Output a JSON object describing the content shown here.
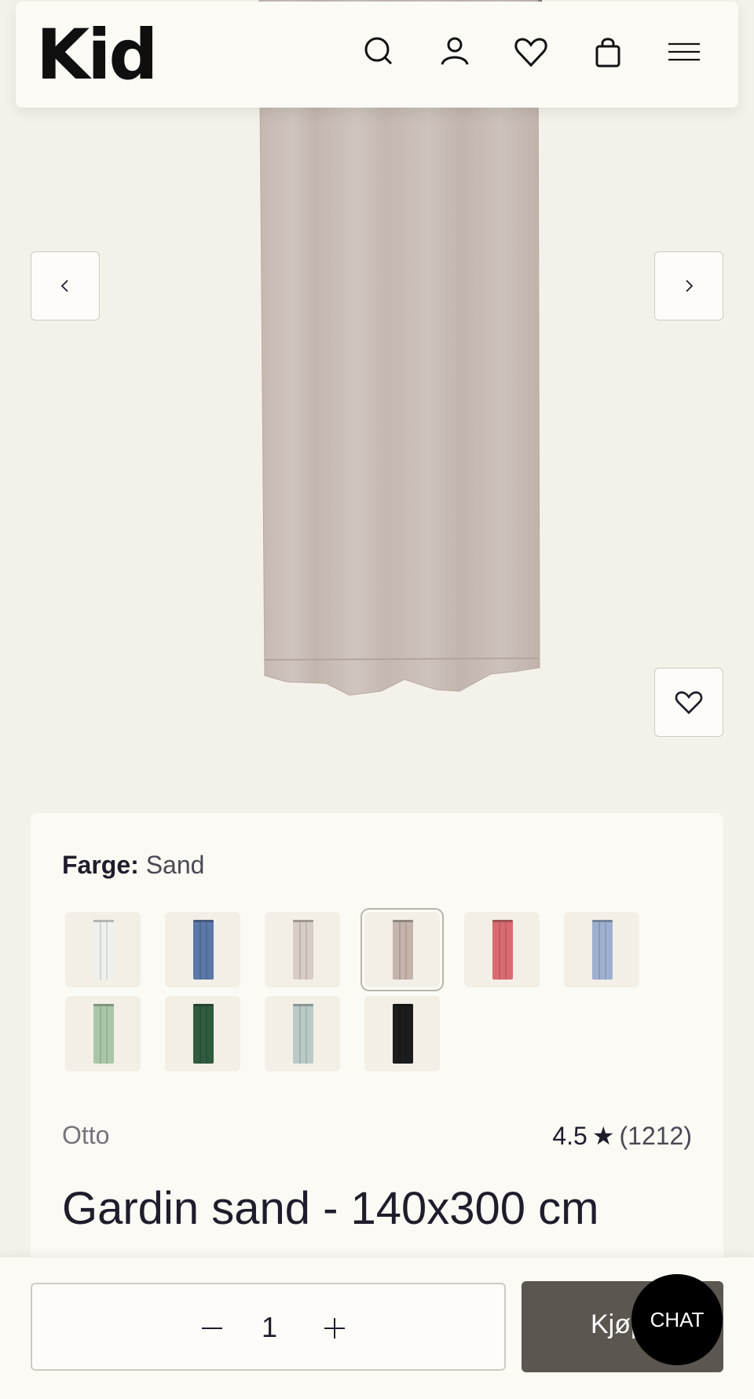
{
  "header": {
    "logo": "Kid",
    "icons": [
      "search-icon",
      "account-icon",
      "heart-icon",
      "bag-icon",
      "menu-icon"
    ]
  },
  "gallery": {
    "prev_icon": "chevron-left-icon",
    "next_icon": "chevron-right-icon",
    "wishlist_icon": "heart-icon",
    "image_color": "#c9bdb6"
  },
  "product": {
    "color_label": "Farge:",
    "color_value": "Sand",
    "swatches": [
      {
        "color": "#eef2ee",
        "selected": false
      },
      {
        "color": "#5a78a8",
        "selected": false
      },
      {
        "color": "#d6cdc5",
        "selected": false
      },
      {
        "color": "#c4b4ac",
        "selected": true
      },
      {
        "color": "#d96a72",
        "selected": false
      },
      {
        "color": "#9db0cf",
        "selected": false
      },
      {
        "color": "#a9c7a8",
        "selected": false
      },
      {
        "color": "#2f5b3e",
        "selected": false
      },
      {
        "color": "#b9cac8",
        "selected": false
      },
      {
        "color": "#1c1c1c",
        "selected": false
      }
    ],
    "brand": "Otto",
    "rating": "4.5",
    "rating_star": "★",
    "review_count": "(1212)",
    "title": "Gardin sand - 140x300 cm"
  },
  "cart": {
    "quantity": "1",
    "buy_label": "Kjøp",
    "chat_label": "CHAT"
  }
}
